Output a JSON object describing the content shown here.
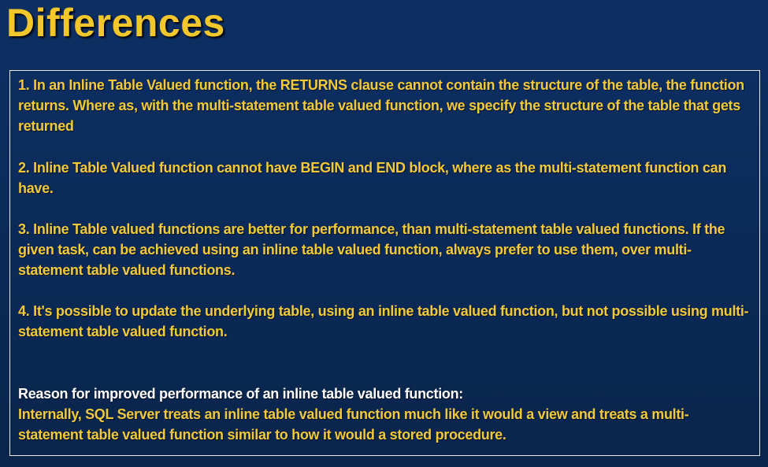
{
  "title": "Differences",
  "points": [
    "1. In an Inline Table Valued function, the RETURNS clause cannot contain the structure of the table, the function returns. Where as, with the multi-statement table valued function, we specify the structure of the table that gets returned",
    "2. Inline Table Valued function cannot have BEGIN and END block, where as the multi-statement function can have.",
    "3. Inline Table valued functions are better for performance, than multi-statement table valued functions. If the given task, can be achieved using an inline table valued function, always prefer to use them, over multi-statement table valued functions.",
    "4. It's possible to update the underlying table, using an inline table valued function, but not possible using multi-statement table valued function."
  ],
  "reason": {
    "heading": "Reason for improved performance of an inline table valued function:",
    "text": "Internally, SQL Server treats an inline table valued function much like it would a view and treats a multi-statement table valued function similar to how it would a stored procedure."
  },
  "colors": {
    "background": "#0b2b5a",
    "title": "#f2c72b",
    "body_text": "#f2c93a",
    "heading_text": "#ffffff",
    "box_border": "#e8e8e8"
  }
}
